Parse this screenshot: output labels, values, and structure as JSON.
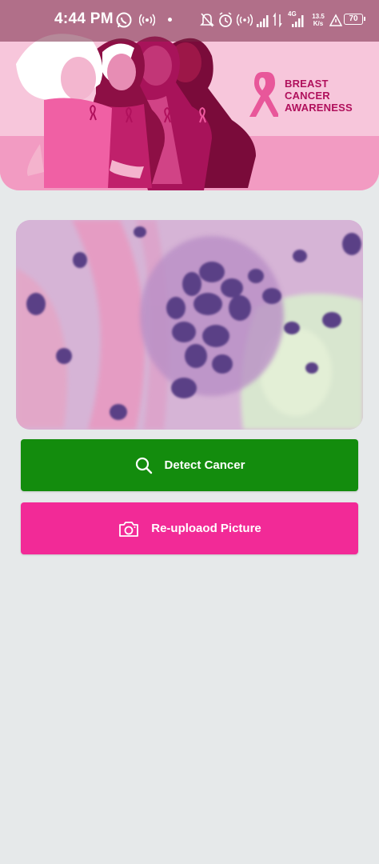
{
  "status_bar": {
    "time": "4:44 PM",
    "network_type": "4G",
    "speed_value": "13.5",
    "speed_unit": "K/s",
    "battery": "70",
    "icons": [
      "whatsapp-icon",
      "hotspot-icon",
      "dot-icon",
      "mute-icon",
      "alarm-icon",
      "wifi-calling-icon",
      "signal-icon",
      "data-arrows-icon",
      "signal-4g-icon",
      "speed-icon",
      "warning-icon",
      "battery-icon"
    ]
  },
  "banner": {
    "title_line1": "BREAST",
    "title_line2": "CANCER",
    "title_line3": "AWARENESS",
    "accent_color": "#b0105c",
    "icons": [
      "ribbon-icon"
    ]
  },
  "sample_image": {
    "name": "histology-sample-image"
  },
  "actions": {
    "detect_label": "Detect Cancer",
    "detect_color": "#138c0d",
    "detect_icon": "search-icon",
    "reupload_label": "Re-uploaod Picture",
    "reupload_color": "#f22a97",
    "reupload_icon": "camera-icon"
  }
}
